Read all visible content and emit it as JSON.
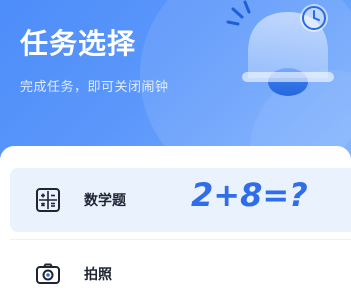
{
  "header": {
    "title": "任务选择",
    "subtitle": "完成任务，即可关闭闹钟"
  },
  "options": [
    {
      "label": "数学题",
      "icon": "calculator-icon",
      "example": "2+8=?",
      "selected": true
    },
    {
      "label": "拍照",
      "icon": "camera-icon",
      "selected": false
    }
  ],
  "colors": {
    "header_gradient_start": "#4d8dfa",
    "header_gradient_end": "#7cb0fc",
    "selected_bg": "#eaf2fe",
    "accent": "#2f6ee8"
  }
}
